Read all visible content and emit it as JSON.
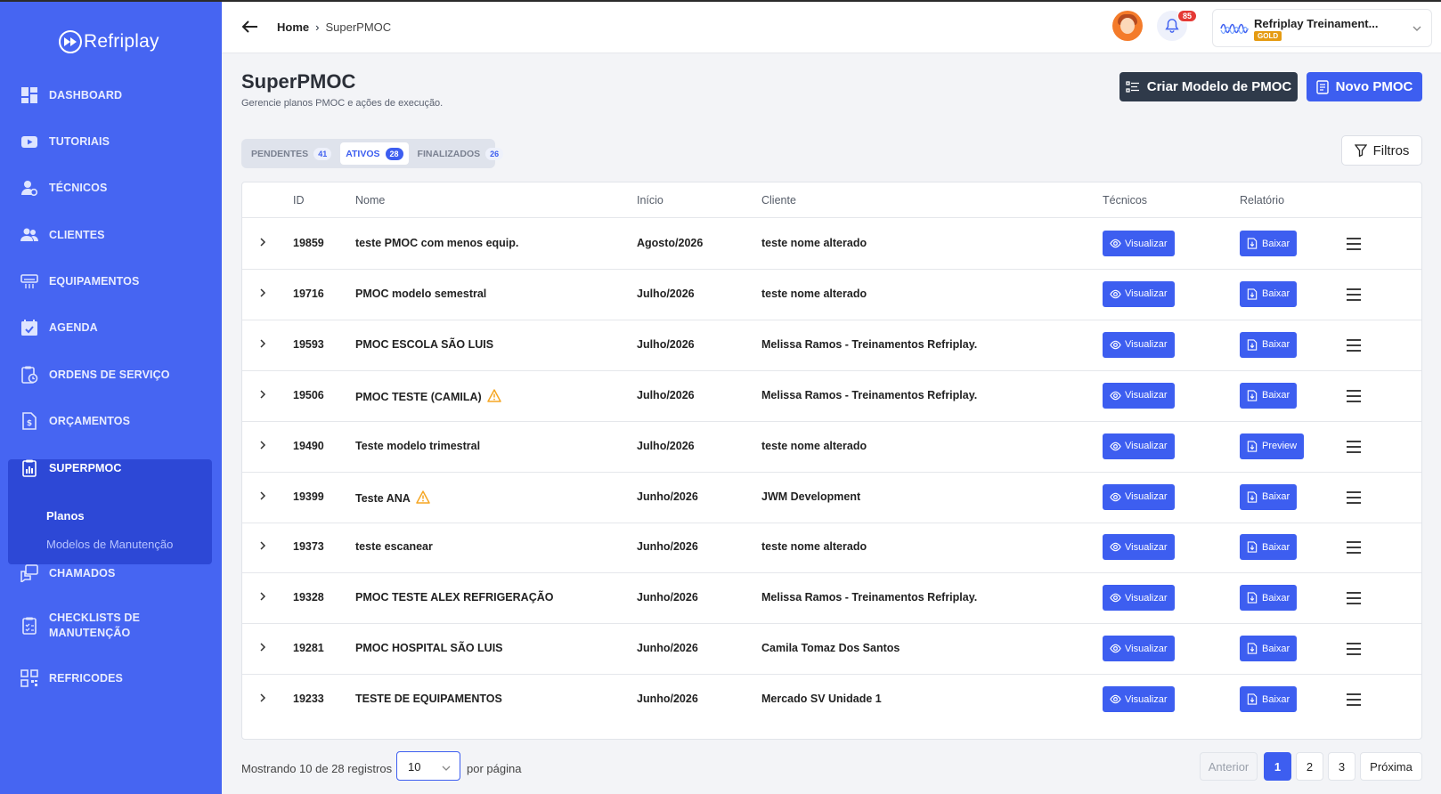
{
  "app": {
    "logo_text": "Refriplay"
  },
  "sidebar": {
    "items": [
      {
        "label": "DASHBOARD",
        "icon": "dashboard-icon"
      },
      {
        "label": "TUTORIAIS",
        "icon": "youtube-icon"
      },
      {
        "label": "TÉCNICOS",
        "icon": "user-gear-icon"
      },
      {
        "label": "CLIENTES",
        "icon": "users-icon"
      },
      {
        "label": "EQUIPAMENTOS",
        "icon": "air-conditioner-icon"
      },
      {
        "label": "AGENDA",
        "icon": "calendar-check-icon"
      },
      {
        "label": "ORDENS DE SERVIÇO",
        "icon": "clipboard-clock-icon"
      },
      {
        "label": "ORÇAMENTOS",
        "icon": "document-dollar-icon"
      },
      {
        "label": "SUPERPMOC",
        "icon": "clipboard-chart-icon"
      },
      {
        "label": "CHAMADOS",
        "icon": "chat-icon"
      },
      {
        "label": "CHECKLISTS DE MANUTENÇÃO",
        "icon": "checklist-icon"
      },
      {
        "label": "REFRICODES",
        "icon": "qr-code-icon"
      }
    ],
    "sub_items": [
      "Planos",
      "Modelos de Manutenção"
    ]
  },
  "header": {
    "breadcrumb_home": "Home",
    "breadcrumb_current": "SuperPMOC",
    "notifications_count": "85",
    "account_name": "Refriplay Treinament...",
    "account_badge": "GOLD"
  },
  "page": {
    "title": "SuperPMOC",
    "subtitle": "Gerencie planos PMOC e ações de execução.",
    "btn_create_model": "Criar Modelo de PMOC",
    "btn_new": "Novo PMOC",
    "btn_filters": "Filtros"
  },
  "tabs": [
    {
      "label": "PENDENTES",
      "count": "41"
    },
    {
      "label": "ATIVOS",
      "count": "28"
    },
    {
      "label": "FINALIZADOS",
      "count": "26"
    }
  ],
  "table": {
    "headers": [
      "ID",
      "Nome",
      "Início",
      "Cliente",
      "Técnicos",
      "Relatório"
    ],
    "rows": [
      {
        "id": "19859",
        "name": "teste PMOC com menos equip.",
        "start": "Agosto/2026",
        "client": "teste nome alterado",
        "tech_btn": "Visualizar",
        "report_btn": "Baixar",
        "warning": false
      },
      {
        "id": "19716",
        "name": "PMOC modelo semestral",
        "start": "Julho/2026",
        "client": "teste nome alterado",
        "tech_btn": "Visualizar",
        "report_btn": "Baixar",
        "warning": false
      },
      {
        "id": "19593",
        "name": "PMOC ESCOLA SÃO LUIS",
        "start": "Julho/2026",
        "client": "Melissa Ramos - Treinamentos Refriplay.",
        "tech_btn": "Visualizar",
        "report_btn": "Baixar",
        "warning": false
      },
      {
        "id": "19506",
        "name": "PMOC TESTE (CAMILA)",
        "start": "Julho/2026",
        "client": "Melissa Ramos - Treinamentos Refriplay.",
        "tech_btn": "Visualizar",
        "report_btn": "Baixar",
        "warning": true
      },
      {
        "id": "19490",
        "name": "Teste modelo trimestral",
        "start": "Julho/2026",
        "client": "teste nome alterado",
        "tech_btn": "Visualizar",
        "report_btn": "Preview",
        "warning": false
      },
      {
        "id": "19399",
        "name": "Teste ANA",
        "start": "Junho/2026",
        "client": "JWM Development",
        "tech_btn": "Visualizar",
        "report_btn": "Baixar",
        "warning": true
      },
      {
        "id": "19373",
        "name": "teste escanear",
        "start": "Junho/2026",
        "client": "teste nome alterado",
        "tech_btn": "Visualizar",
        "report_btn": "Baixar",
        "warning": false
      },
      {
        "id": "19328",
        "name": "PMOC TESTE ALEX REFRIGERAÇÃO",
        "start": "Junho/2026",
        "client": "Melissa Ramos - Treinamentos Refriplay.",
        "tech_btn": "Visualizar",
        "report_btn": "Baixar",
        "warning": false
      },
      {
        "id": "19281",
        "name": "PMOC HOSPITAL SÃO LUIS",
        "start": "Junho/2026",
        "client": "Camila Tomaz Dos Santos",
        "tech_btn": "Visualizar",
        "report_btn": "Baixar",
        "warning": false
      },
      {
        "id": "19233",
        "name": "TESTE DE EQUIPAMENTOS",
        "start": "Junho/2026",
        "client": "Mercado SV Unidade 1",
        "tech_btn": "Visualizar",
        "report_btn": "Baixar",
        "warning": false
      }
    ]
  },
  "footer": {
    "showing": "Mostrando 10 de 28 registros",
    "per_page_value": "10",
    "per_page_suffix": "por página",
    "prev": "Anterior",
    "pages": [
      "1",
      "2",
      "3"
    ],
    "next": "Próxima"
  },
  "colors": {
    "primary": "#3d5ef0",
    "sidebar": "#4665f2",
    "dark_button": "#2f3a4a",
    "warning": "#f5a623",
    "gold": "#e59b12"
  }
}
